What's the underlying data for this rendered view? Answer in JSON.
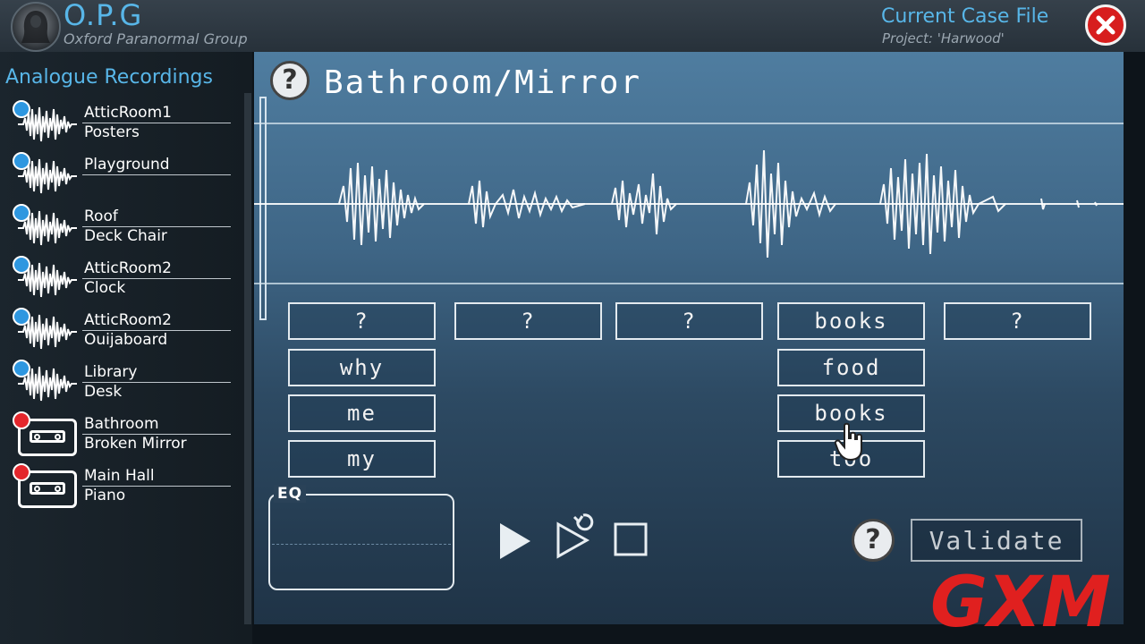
{
  "header": {
    "org_title": "O.P.G",
    "org_subtitle": "Oxford Paranormal Group",
    "case_title": "Current Case File",
    "case_project": "Project: 'Harwood'"
  },
  "sidebar": {
    "title": "Analogue Recordings",
    "recordings": [
      {
        "line1": "AtticRoom1",
        "line2": "Posters",
        "type": "wave",
        "status": "blue"
      },
      {
        "line1": "Playground",
        "line2": "",
        "type": "wave",
        "status": "blue"
      },
      {
        "line1": "Roof",
        "line2": "Deck Chair",
        "type": "wave",
        "status": "blue"
      },
      {
        "line1": "AtticRoom2",
        "line2": "Clock",
        "type": "wave",
        "status": "blue"
      },
      {
        "line1": "AtticRoom2",
        "line2": "Ouijaboard",
        "type": "wave",
        "status": "blue"
      },
      {
        "line1": "Library",
        "line2": "Desk",
        "type": "wave",
        "status": "blue"
      },
      {
        "line1": "Bathroom",
        "line2": "Broken Mirror",
        "type": "tape",
        "status": "red"
      },
      {
        "line1": "Main Hall",
        "line2": "Piano",
        "type": "tape",
        "status": "red"
      }
    ]
  },
  "main": {
    "recording_title": "Bathroom/Mirror",
    "help_symbol": "?",
    "slots": [
      "?",
      "?",
      "?",
      "books",
      "?"
    ],
    "col1_options": [
      "why",
      "me",
      "my"
    ],
    "col4_options": [
      "food",
      "books",
      "too"
    ],
    "eq_label": "EQ",
    "validate_label": "Validate"
  },
  "watermark": "GXM",
  "colors": {
    "accent_blue": "#58b6e8",
    "status_blue": "#2e97e0",
    "status_red": "#e4262c",
    "close_red": "#d71d1d"
  },
  "icons": [
    "close-icon",
    "help-icon",
    "play-icon",
    "replay-icon",
    "stop-icon",
    "cassette-icon",
    "waveform-icon",
    "hand-cursor-icon"
  ]
}
